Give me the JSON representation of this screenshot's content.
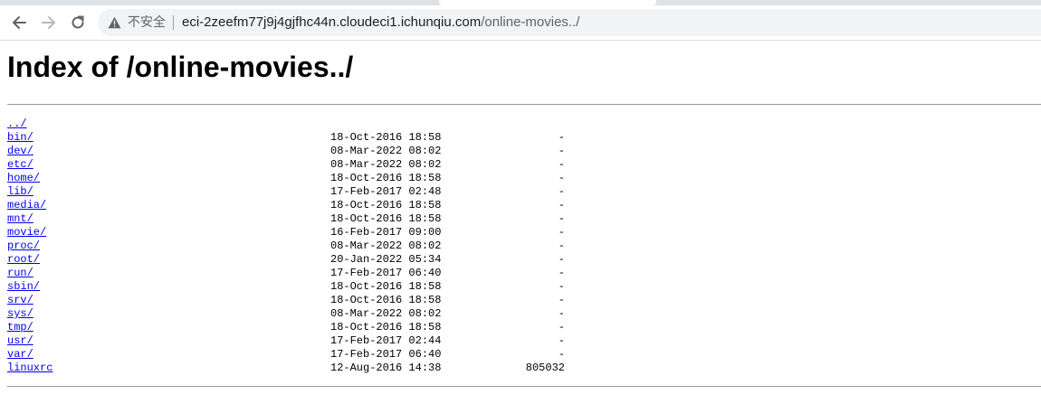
{
  "browser": {
    "security_label": "不安全",
    "url_host": "eci-2zeefm77j9j4gjfhc44n.cloudeci1.ichunqiu.com",
    "url_path": "/online-movies../"
  },
  "page": {
    "title": "Index of /online-movies../",
    "link_color": "#0000ee"
  },
  "listing": {
    "parent": "../",
    "entries": [
      {
        "name": "bin/",
        "date": "18-Oct-2016 18:58",
        "size": "-"
      },
      {
        "name": "dev/",
        "date": "08-Mar-2022 08:02",
        "size": "-"
      },
      {
        "name": "etc/",
        "date": "08-Mar-2022 08:02",
        "size": "-"
      },
      {
        "name": "home/",
        "date": "18-Oct-2016 18:58",
        "size": "-"
      },
      {
        "name": "lib/",
        "date": "17-Feb-2017 02:48",
        "size": "-"
      },
      {
        "name": "media/",
        "date": "18-Oct-2016 18:58",
        "size": "-"
      },
      {
        "name": "mnt/",
        "date": "18-Oct-2016 18:58",
        "size": "-"
      },
      {
        "name": "movie/",
        "date": "16-Feb-2017 09:00",
        "size": "-"
      },
      {
        "name": "proc/",
        "date": "08-Mar-2022 08:02",
        "size": "-"
      },
      {
        "name": "root/",
        "date": "20-Jan-2022 05:34",
        "size": "-"
      },
      {
        "name": "run/",
        "date": "17-Feb-2017 06:40",
        "size": "-"
      },
      {
        "name": "sbin/",
        "date": "18-Oct-2016 18:58",
        "size": "-"
      },
      {
        "name": "srv/",
        "date": "18-Oct-2016 18:58",
        "size": "-"
      },
      {
        "name": "sys/",
        "date": "08-Mar-2022 08:02",
        "size": "-"
      },
      {
        "name": "tmp/",
        "date": "18-Oct-2016 18:58",
        "size": "-"
      },
      {
        "name": "usr/",
        "date": "17-Feb-2017 02:44",
        "size": "-"
      },
      {
        "name": "var/",
        "date": "17-Feb-2017 06:40",
        "size": "-"
      },
      {
        "name": "linuxrc",
        "date": "12-Aug-2016 14:38",
        "size": "805032"
      }
    ]
  }
}
